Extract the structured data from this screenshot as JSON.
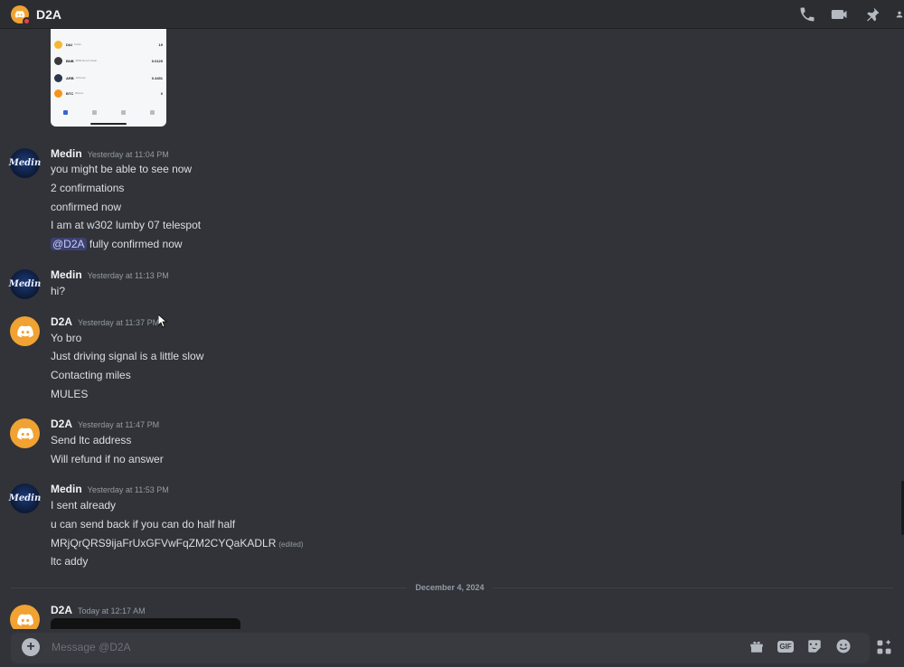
{
  "header": {
    "title": "D2A"
  },
  "attachment": {
    "assets": [
      {
        "symbol": "DAI",
        "name": "Tether",
        "amount": "19",
        "color": "#f4b731"
      },
      {
        "symbol": "BNB",
        "name": "BNB Smart Chain",
        "amount": "0.0129",
        "color": "#3a3a3a"
      },
      {
        "symbol": "ARB",
        "name": "Arbitrum",
        "amount": "0.3451",
        "color": "#2d374b"
      },
      {
        "symbol": "BTC",
        "name": "Bitcoin",
        "amount": "0",
        "color": "#f7931a"
      }
    ]
  },
  "messages": [
    {
      "author": "Medin",
      "timestamp": "Yesterday at 11:04 PM",
      "lines": [
        "you might be able to see now",
        "2 confirmations",
        "confirmed now",
        "I am at w302 lumby 07 telespot"
      ],
      "mention_line": {
        "mention": "@D2A",
        "text": " fully confirmed now"
      }
    },
    {
      "author": "Medin",
      "timestamp": "Yesterday at 11:13 PM",
      "lines": [
        "hi?"
      ]
    },
    {
      "author": "D2A",
      "timestamp": "Yesterday at 11:37 PM",
      "lines": [
        "Yo bro",
        "Just driving signal is a little slow",
        "Contacting miles",
        "MULES"
      ]
    },
    {
      "author": "D2A",
      "timestamp": "Yesterday at 11:47 PM",
      "lines": [
        "Send ltc address",
        "Will refund if no answer"
      ]
    },
    {
      "author": "Medin",
      "timestamp": "Yesterday at 11:53 PM",
      "lines": [
        "I sent already",
        "u can send back if you can do half half",
        "MRjQrQRS9ijaFrUxGFVwFqZM2CYQaKADLR",
        "ltc addy"
      ],
      "edited_label": "(edited)"
    },
    {
      "author": "D2A",
      "timestamp": "Today at 12:17 AM",
      "lines": []
    }
  ],
  "divider": {
    "label": "December 4, 2024"
  },
  "composer": {
    "placeholder": "Message @D2A",
    "gif_label": "GIF"
  },
  "avatar_text": {
    "medin": "Medin"
  },
  "colors": {
    "background": "#313338",
    "accent": "#f0a232",
    "mention_bg": "#3c4270"
  }
}
